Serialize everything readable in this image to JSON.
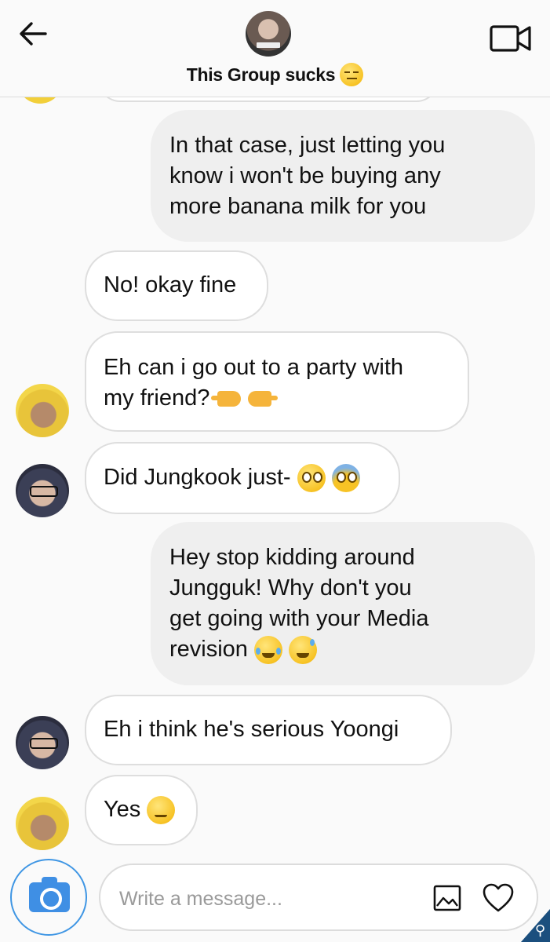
{
  "header": {
    "title": "This Group sucks",
    "title_emoji": "expressionless-face",
    "back_icon": "arrow-left-icon",
    "video_icon": "video-camera-icon"
  },
  "messages": [
    {
      "direction": "outgoing",
      "lines": [
        "In that case, just letting you",
        "know i won't be buying any",
        "more banana milk for you"
      ]
    },
    {
      "direction": "incoming",
      "lines": [
        "No! okay fine"
      ]
    },
    {
      "direction": "incoming",
      "avatar": "yellow",
      "lines": [
        "Eh can i go out to a party with",
        "my friend?"
      ],
      "emoji": [
        "backhand-index-pointing-right",
        "backhand-index-pointing-left"
      ]
    },
    {
      "direction": "incoming",
      "avatar": "glasses",
      "lines": [
        "Did Jungkook just-"
      ],
      "emoji": [
        "flushed-face",
        "screaming-face"
      ]
    },
    {
      "direction": "outgoing",
      "lines": [
        "Hey stop kidding around",
        "Jungguk! Why don't you",
        "get going with your Media",
        "revision"
      ],
      "emoji": [
        "face-with-tears-of-joy",
        "grinning-face-with-sweat"
      ]
    },
    {
      "direction": "incoming",
      "avatar": "glasses",
      "lines": [
        "Eh i think he's serious Yoongi"
      ]
    },
    {
      "direction": "incoming",
      "avatar": "yellow",
      "lines": [
        "Yes"
      ],
      "emoji": [
        "confounded-face"
      ]
    }
  ],
  "composer": {
    "placeholder": "Write a message...",
    "camera_icon": "camera-icon",
    "gallery_icon": "image-icon",
    "heart_icon": "heart-icon"
  },
  "colors": {
    "accent": "#3f8fe4",
    "outgoing_bubble": "#efefef",
    "incoming_border": "#dedede"
  }
}
